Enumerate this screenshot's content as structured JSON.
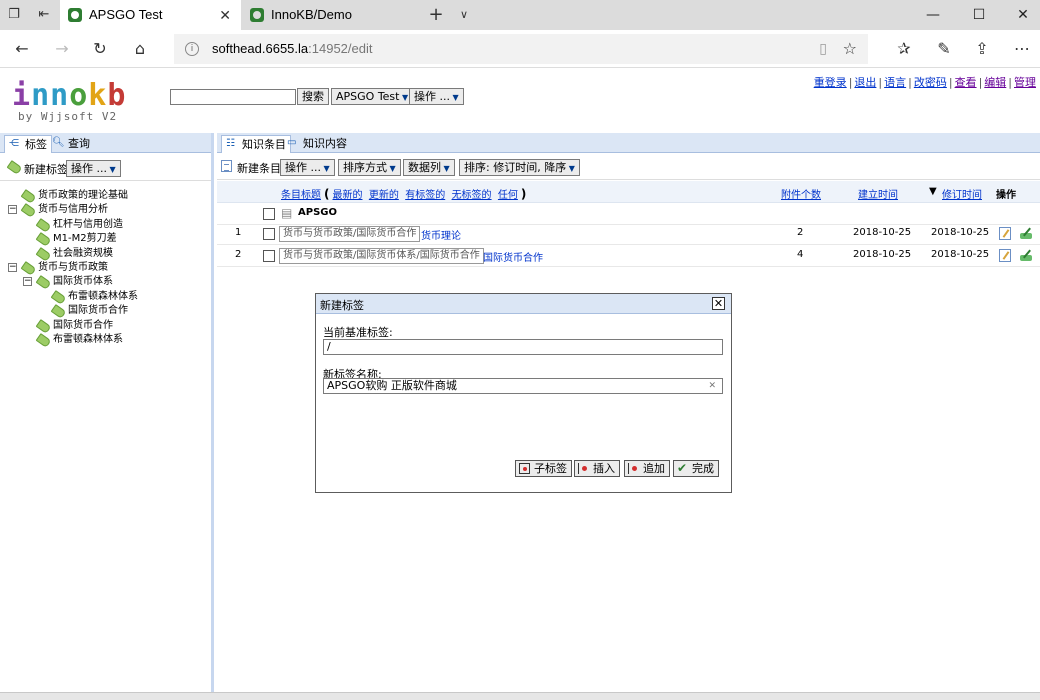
{
  "browser": {
    "tabs": [
      {
        "title": "APSGO Test",
        "active": true
      },
      {
        "title": "InnoKB/Demo",
        "active": false
      }
    ],
    "url_host": "softhead.6655.la",
    "url_rest": ":14952/edit"
  },
  "header": {
    "logo_letters": [
      "i",
      "n",
      "n",
      "o",
      "k",
      "b"
    ],
    "byline": "by Wjjsoft V2",
    "search_button": "搜索",
    "kb_select": "APSGO Test",
    "ops_select": "操作 ...",
    "links": [
      "重登录",
      "退出",
      "语言",
      "改密码",
      "查看",
      "编辑",
      "管理"
    ]
  },
  "left_panel": {
    "tabs": [
      "标签",
      "查询"
    ],
    "new_tag": "新建标签",
    "ops_select": "操作 ...",
    "tree": [
      {
        "label": "货币政策的理论基础",
        "level": 0,
        "toggle": ""
      },
      {
        "label": "货币与信用分析",
        "level": 0,
        "toggle": "−"
      },
      {
        "label": "杠杆与信用创造",
        "level": 1,
        "toggle": ""
      },
      {
        "label": "M1-M2剪刀差",
        "level": 1,
        "toggle": ""
      },
      {
        "label": "社会融资规模",
        "level": 1,
        "toggle": ""
      },
      {
        "label": "货币与货币政策",
        "level": 0,
        "toggle": "−"
      },
      {
        "label": "国际货币体系",
        "level": 1,
        "toggle": "−"
      },
      {
        "label": "布雷顿森林体系",
        "level": 2,
        "toggle": ""
      },
      {
        "label": "国际货币合作",
        "level": 2,
        "toggle": ""
      },
      {
        "label": "国际货币合作",
        "level": 1,
        "toggle": ""
      },
      {
        "label": "布雷顿森林体系",
        "level": 1,
        "toggle": ""
      }
    ]
  },
  "main_panel": {
    "tabs": [
      "知识条目",
      "知识内容"
    ],
    "new_item": "新建条目",
    "toolbar": [
      "操作 ...",
      "排序方式",
      "数据列",
      "排序: 修订时间, 降序"
    ],
    "columns": {
      "title": "条目标题",
      "paren_open": "(",
      "filters": [
        "最新的",
        "更新的",
        "有标签的",
        "无标签的",
        "任何"
      ],
      "paren_close": ")",
      "attachments": "附件个数",
      "created": "建立时间",
      "sort_arrow": "▼",
      "modified": "修订时间",
      "actions": "操作"
    },
    "group": "APSGO",
    "rows": [
      {
        "num": "1",
        "path": "货币与货币政策/国际货币合作",
        "title": "货币理论",
        "attachments": "2",
        "created": "2018-10-25",
        "modified": "2018-10-25"
      },
      {
        "num": "2",
        "path": "货币与货币政策/国际货币体系/国际货币合作",
        "title": "国际货币合作",
        "attachments": "4",
        "created": "2018-10-25",
        "modified": "2018-10-25"
      }
    ]
  },
  "dialog": {
    "title": "新建标签",
    "close_glyph": "✕",
    "base_label": "当前基准标签:",
    "base_value": "/",
    "name_label": "新标签名称:",
    "name_value": "APSGO软购 正版软件商城",
    "buttons": [
      "子标签",
      "插入",
      "追加",
      "完成"
    ]
  }
}
